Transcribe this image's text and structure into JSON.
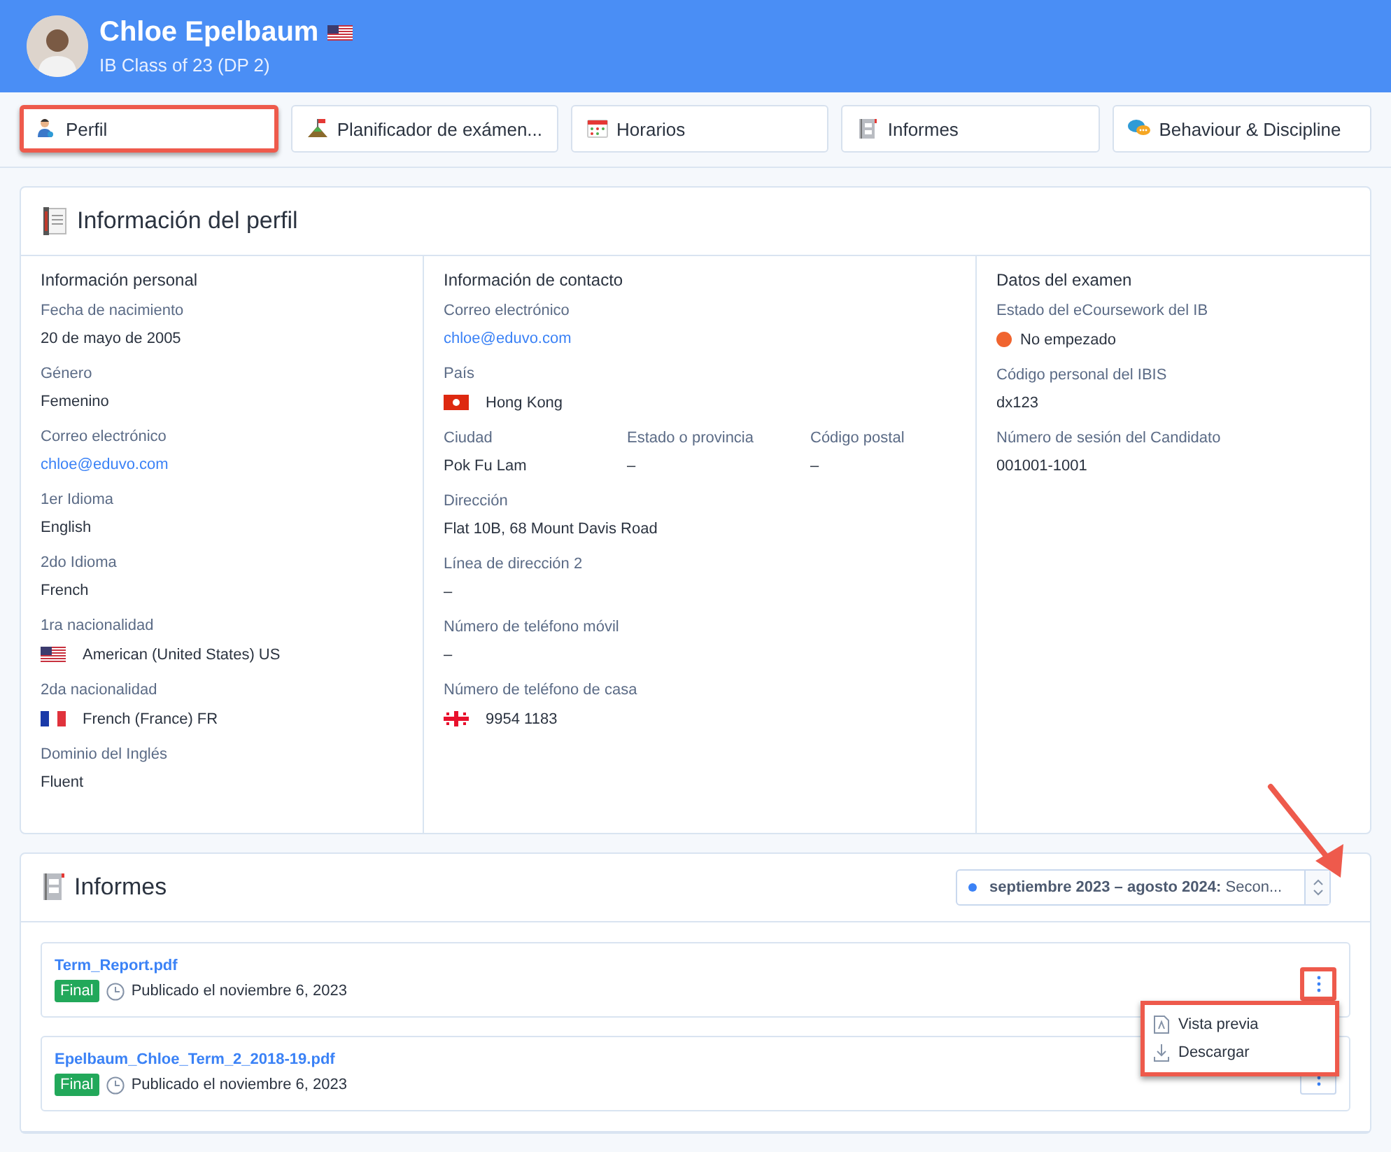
{
  "header": {
    "name": "Chloe Epelbaum",
    "name_flag": {
      "kind": "stripes"
    },
    "subtitle": "IB Class of 23 (DP 2)"
  },
  "tabs": [
    {
      "label": "Perfil",
      "selected": true
    },
    {
      "label": "Planificador de exámen...",
      "selected": false
    },
    {
      "label": "Horarios",
      "selected": false
    },
    {
      "label": "Informes",
      "selected": false
    },
    {
      "label": "Behaviour & Discipline",
      "selected": false
    }
  ],
  "profile": {
    "title": "Información del perfil",
    "columns": [
      {
        "title": "Información personal",
        "fields": [
          {
            "kind": "text",
            "label": "Fecha de nacimiento",
            "value": "20 de mayo de 2005"
          },
          {
            "kind": "text",
            "label": "Género",
            "value": "Femenino"
          },
          {
            "kind": "link",
            "label": "Correo electrónico",
            "value": "chloe@eduvo.com"
          },
          {
            "kind": "text",
            "label": "1er Idioma",
            "value": "English"
          },
          {
            "kind": "text",
            "label": "2do Idioma",
            "value": "French"
          },
          {
            "kind": "flag",
            "label": "1ra nacionalidad",
            "value": "American (United States) US",
            "flag": {
              "kind": "stripes"
            }
          },
          {
            "kind": "flag",
            "label": "2da nacionalidad",
            "value": "French (France) FR",
            "flag": {
              "kind": "tricolour"
            }
          },
          {
            "kind": "text",
            "label": "Dominio del Inglés",
            "value": "Fluent"
          }
        ]
      },
      {
        "title": "Información de contacto",
        "fields": [
          {
            "kind": "link",
            "label": "Correo electrónico",
            "value": "chloe@eduvo.com"
          },
          {
            "kind": "flag",
            "label": "País",
            "value": "Hong Kong",
            "flag": {
              "kind": "flower"
            }
          },
          {
            "kind": "row",
            "items": [
              {
                "kind": "text",
                "label": "Ciudad",
                "value": "Pok Fu Lam"
              },
              {
                "kind": "text",
                "label": "Estado o provincia",
                "value": "–"
              },
              {
                "kind": "text",
                "label": "Código postal",
                "value": "–"
              }
            ]
          },
          {
            "kind": "text",
            "label": "Dirección",
            "value": "Flat 10B, 68 Mount Davis Road"
          },
          {
            "kind": "text",
            "label": "Línea de dirección 2",
            "value": "–"
          },
          {
            "kind": "text",
            "label": "Número de teléfono móvil",
            "value": "–"
          },
          {
            "kind": "flag",
            "label": "Número de teléfono de casa",
            "value": "9954 1183",
            "flag": {
              "kind": "crosses"
            }
          }
        ]
      },
      {
        "title": "Datos del examen",
        "fields": [
          {
            "kind": "status",
            "label": "Estado del eCoursework del IB",
            "value": "No empezado",
            "color": "#f0642f"
          },
          {
            "kind": "text",
            "label": "Código personal del IBIS",
            "value": "dx123"
          },
          {
            "kind": "text",
            "label": "Número de sesión del Candidato",
            "value": "001001-1001"
          }
        ]
      }
    ]
  },
  "reports": {
    "title": "Informes",
    "period": {
      "bold": "septiembre 2023 – agosto 2024:",
      "rest": " Secon...",
      "color": "#3b82f6",
      "highlighted": true
    },
    "items": [
      {
        "file": "Term_Report.pdf",
        "badge": "Final",
        "published": "Publicado el noviembre 6, 2023",
        "menu_highlighted": true
      },
      {
        "file": "Epelbaum_Chloe_Term_2_2018-19.pdf",
        "badge": "Final",
        "published": "Publicado el noviembre 6, 2023",
        "menu_highlighted": false
      }
    ],
    "menu": {
      "highlighted": true,
      "items": [
        {
          "kind": "preview",
          "label": "Vista previa"
        },
        {
          "kind": "download",
          "label": "Descargar"
        }
      ]
    }
  }
}
